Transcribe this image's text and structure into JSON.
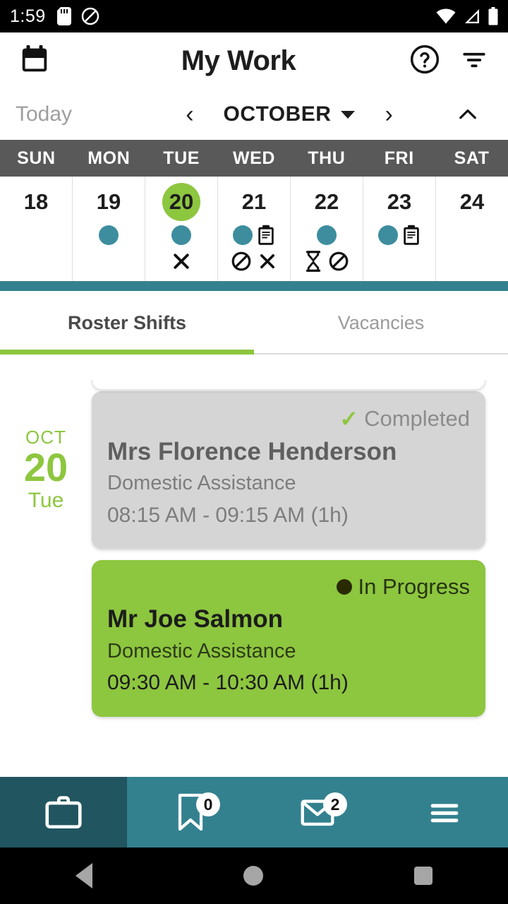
{
  "status_bar": {
    "time": "1:59",
    "left_icons": [
      "sd-card-icon",
      "do-not-disturb-icon"
    ],
    "right_icons": [
      "wifi-icon",
      "cellular-signal-icon",
      "battery-icon"
    ]
  },
  "header": {
    "title": "My Work",
    "calendar_icon": "calendar-icon",
    "help_icon": "help-circle-icon",
    "filter_icon": "filter-icon"
  },
  "month_nav": {
    "today_label": "Today",
    "prev_label": "‹",
    "month_label": "OCTOBER",
    "next_label": "›",
    "collapse_label": "⌃"
  },
  "calendar": {
    "day_headers": [
      "SUN",
      "MON",
      "TUE",
      "WED",
      "THU",
      "FRI",
      "SAT"
    ],
    "selected_day": "20",
    "accent_green": "#8DC63F",
    "accent_teal": "#3D8D9E",
    "header_gray": "#595959",
    "days": [
      {
        "num": "18",
        "selected": false,
        "icons_row1": [],
        "icons_row2": []
      },
      {
        "num": "19",
        "selected": false,
        "icons_row1": [
          "shift-dot-icon"
        ],
        "icons_row2": []
      },
      {
        "num": "20",
        "selected": true,
        "icons_row1": [
          "shift-dot-icon"
        ],
        "icons_row2": [
          "cross-icon"
        ]
      },
      {
        "num": "21",
        "selected": false,
        "icons_row1": [
          "shift-dot-icon",
          "clipboard-icon"
        ],
        "icons_row2": [
          "no-entry-icon",
          "cross-icon"
        ]
      },
      {
        "num": "22",
        "selected": false,
        "icons_row1": [
          "shift-dot-icon"
        ],
        "icons_row2": [
          "hourglass-icon",
          "no-entry-icon"
        ]
      },
      {
        "num": "23",
        "selected": false,
        "icons_row1": [
          "shift-dot-icon",
          "clipboard-icon"
        ],
        "icons_row2": []
      },
      {
        "num": "24",
        "selected": false,
        "icons_row1": [],
        "icons_row2": []
      }
    ]
  },
  "tabs": {
    "items": [
      {
        "label": "Roster Shifts",
        "active": true
      },
      {
        "label": "Vacancies",
        "active": false
      }
    ]
  },
  "shifts": [
    {
      "date": {
        "month": "OCT",
        "day": "20",
        "dow": "Tue"
      },
      "status": "Completed",
      "status_icon": "check-icon",
      "client": "Mrs Florence Henderson",
      "service": "Domestic Assistance",
      "time": "08:15 AM - 09:15 AM (1h)",
      "state": "completed"
    },
    {
      "date": {
        "month": "",
        "day": "",
        "dow": ""
      },
      "status": "In Progress",
      "status_icon": "dot-icon",
      "client": "Mr Joe Salmon",
      "service": "Domestic Assistance",
      "time": "09:30 AM - 10:30 AM (1h)",
      "state": "inprogress"
    }
  ],
  "bottom_nav": {
    "items": [
      {
        "icon": "briefcase-icon",
        "badge": null,
        "active": true
      },
      {
        "icon": "bookmark-icon",
        "badge": "0",
        "active": false
      },
      {
        "icon": "envelope-icon",
        "badge": "2",
        "active": false
      },
      {
        "icon": "hamburger-menu-icon",
        "badge": null,
        "active": false
      }
    ],
    "bg_color": "#33818F",
    "active_bg_color": "#215560"
  },
  "android_nav": {
    "back": "back-triangle-icon",
    "home": "home-circle-icon",
    "recents": "recents-square-icon"
  }
}
